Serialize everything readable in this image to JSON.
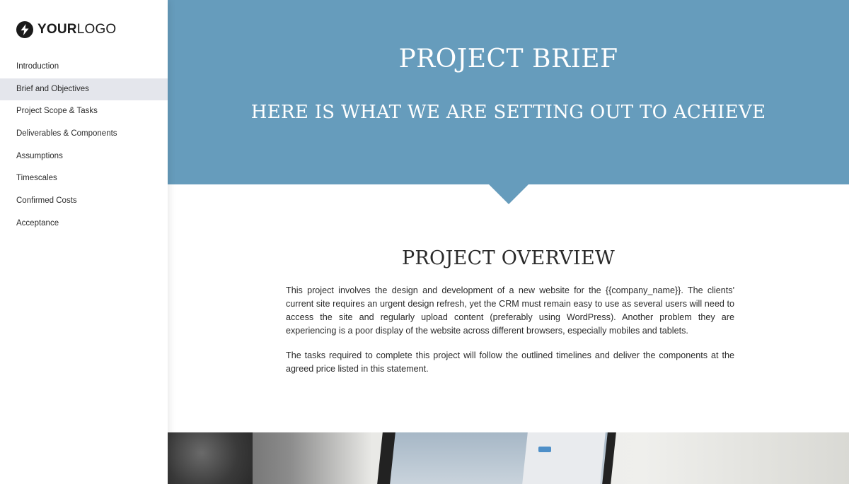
{
  "sidebar": {
    "logo": {
      "icon": "lightning-bolt-icon",
      "text_bold": "YOUR",
      "text_light": "LOGO"
    },
    "items": [
      {
        "label": "Introduction",
        "active": false
      },
      {
        "label": "Brief and Objectives",
        "active": true
      },
      {
        "label": "Project Scope & Tasks",
        "active": false
      },
      {
        "label": "Deliverables & Components",
        "active": false
      },
      {
        "label": "Assumptions",
        "active": false
      },
      {
        "label": "Timescales",
        "active": false
      },
      {
        "label": "Confirmed Costs",
        "active": false
      },
      {
        "label": "Acceptance",
        "active": false
      }
    ]
  },
  "hero": {
    "title": "PROJECT BRIEF",
    "subtitle": "HERE IS WHAT WE ARE SETTING OUT TO ACHIEVE",
    "color": "#669cbc"
  },
  "overview": {
    "title": "PROJECT OVERVIEW",
    "paragraphs": [
      "This project involves the design and development of a new website for the {{company_name}}. The clients' current site requires an urgent design refresh, yet the CRM must remain easy to use as several users will need to access the site and regularly upload content (preferably using WordPress).  Another problem they are experiencing is a poor display of the website across different browsers, especially mobiles and tablets.",
      "The tasks required to complete this project will follow the outlined timelines and deliver the components at the agreed price listed in this statement."
    ]
  },
  "colors": {
    "accent": "#669cbc",
    "sidebar_active": "#e4e6ec",
    "text": "#2a2a2a"
  }
}
